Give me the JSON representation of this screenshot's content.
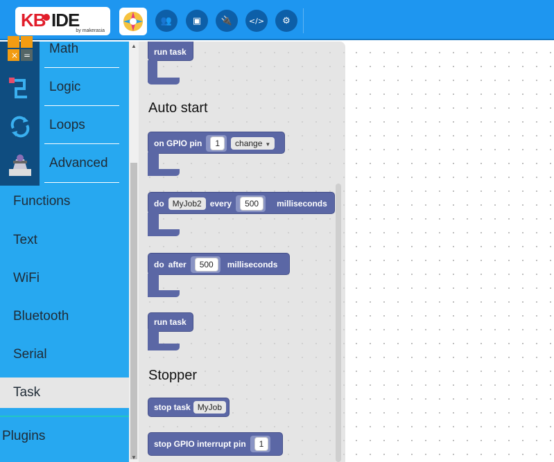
{
  "header": {
    "logo_text_kb": "KB",
    "logo_text_ide": "IDE",
    "logo_by": "by makerasia",
    "buttons": [
      {
        "icon": "users-icon",
        "glyph": "👥"
      },
      {
        "icon": "chip-icon",
        "glyph": "▣"
      },
      {
        "icon": "plug-icon",
        "glyph": "🔌"
      },
      {
        "icon": "code-icon",
        "glyph": "</>"
      },
      {
        "icon": "gear-icon",
        "glyph": "⚙"
      }
    ]
  },
  "sidebar": {
    "items": [
      {
        "label": "Math"
      },
      {
        "label": "Logic"
      },
      {
        "label": "Loops"
      },
      {
        "label": "Advanced"
      },
      {
        "label": "Functions"
      },
      {
        "label": "Text"
      },
      {
        "label": "WiFi"
      },
      {
        "label": "Bluetooth"
      },
      {
        "label": "Serial"
      },
      {
        "label": "Task"
      },
      {
        "label": "Plugins"
      }
    ]
  },
  "flyout": {
    "top_block": {
      "label": "run task"
    },
    "section_auto": "Auto start",
    "gpio_block": {
      "label": "on GPIO pin",
      "pin": "1",
      "mode": "change"
    },
    "every_block": {
      "do": "do",
      "job": "MyJob2",
      "every": "every",
      "ms": "500",
      "unit": "milliseconds"
    },
    "after_block": {
      "do": "do",
      "after": "after",
      "ms": "500",
      "unit": "milliseconds"
    },
    "run_block": {
      "label": "run task"
    },
    "section_stopper": "Stopper",
    "stop_task_block": {
      "label": "stop task",
      "job": "MyJob"
    },
    "stop_gpio_block": {
      "label": "stop GPIO interrupt pin",
      "pin": "1"
    }
  }
}
